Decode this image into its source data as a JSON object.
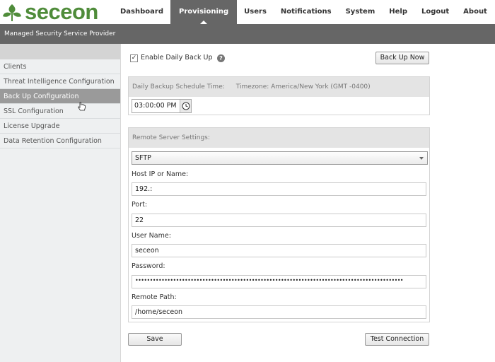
{
  "app": {
    "logo_text": "seceon",
    "subtitle": "Managed Security Service Provider"
  },
  "nav": [
    {
      "label": "Dashboard"
    },
    {
      "label": "Provisioning"
    },
    {
      "label": "Users"
    },
    {
      "label": "Notifications"
    },
    {
      "label": "System"
    },
    {
      "label": "Help"
    },
    {
      "label": "Logout"
    },
    {
      "label": "About"
    }
  ],
  "sidebar": {
    "items": [
      {
        "label": "Clients"
      },
      {
        "label": "Threat Intelligence Configuration"
      },
      {
        "label": "Back Up Configuration"
      },
      {
        "label": "SSL Configuration"
      },
      {
        "label": "License Upgrade"
      },
      {
        "label": "Data Retention Configuration"
      }
    ]
  },
  "backup": {
    "enable_label": "Enable Daily Back Up",
    "enable_checked": true,
    "backup_now_label": "Back Up Now",
    "schedule_label": "Daily Backup Schedule Time:",
    "timezone_label": "Timezone: America/New York (GMT -0400)",
    "time_value": "03:00:00 PM"
  },
  "remote": {
    "header": "Remote Server Settings:",
    "protocol": "SFTP",
    "host_label": "Host IP or Name:",
    "host_value": "192.:",
    "port_label": "Port:",
    "port_value": "22",
    "user_label": "User Name:",
    "user_value": "seceon",
    "password_label": "Password:",
    "password_value": "••••••••••••••••••••••••••••••••••••••••••••••••••••••••••••••••••••••••••••••••••••••••••••",
    "path_label": "Remote Path:",
    "path_value": "/home/seceon"
  },
  "actions": {
    "save_label": "Save",
    "test_label": "Test Connection"
  },
  "colors": {
    "brand_green": "#4f8c3a",
    "header_gray": "#666666",
    "active_side": "#9a9a9a"
  },
  "icons": {
    "logo": "leaf-logo-icon",
    "help": "help-icon",
    "clock": "clock-icon",
    "dropdown": "chevron-down-icon",
    "cursor": "hand-cursor-icon"
  }
}
